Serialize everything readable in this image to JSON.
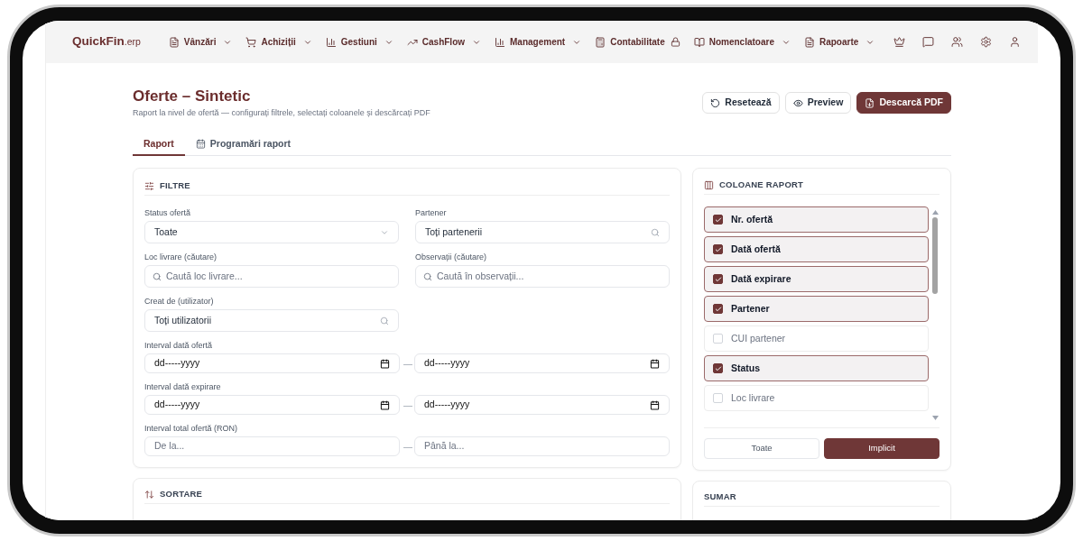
{
  "nav": {
    "logo": "**QuickFin**.erp",
    "menus": [
      {
        "label": "Vânzări",
        "kind": "dropdown"
      },
      {
        "label": "Achiziții",
        "kind": "dropdown"
      },
      {
        "label": "Gestiuni",
        "kind": "dropdown"
      },
      {
        "label": "CashFlow",
        "kind": "dropdown"
      },
      {
        "label": "Management",
        "kind": "dropdown"
      },
      {
        "label": "Contabilitate",
        "kind": "locked"
      },
      {
        "label": "Nomenclatoare",
        "kind": "dropdown"
      },
      {
        "label": "Rapoarte",
        "kind": "dropdown"
      }
    ]
  },
  "header": {
    "title": "Oferte – Sintetic",
    "subtitle": "Raport la nivel de ofertă — configurați filtrele, selectați coloanele și descărcați PDF",
    "actions": [
      {
        "label": "Resetează",
        "kind": "outline"
      },
      {
        "label": "Preview",
        "kind": "outline"
      },
      {
        "label": "Descarcă PDF",
        "kind": "primary"
      }
    ]
  },
  "tabs": [
    {
      "label": "Raport",
      "selected": true
    },
    {
      "label": "Programări raport",
      "selected": false
    }
  ],
  "filters": {
    "title": "FILTRE",
    "fields": [
      {
        "label": "Status ofertă",
        "kind": "select",
        "value": "Toate"
      },
      {
        "label": "Partener",
        "kind": "lookup",
        "value": "Toți partenerii"
      },
      {
        "label": "Loc livrare (căutare)",
        "kind": "search",
        "placeholder": "Caută loc livrare..."
      },
      {
        "label": "Observații (căutare)",
        "kind": "search",
        "placeholder": "Caută în observații..."
      },
      {
        "label": "Creat de (utilizator)",
        "kind": "lookup",
        "value": "Toți utilizatorii"
      },
      {
        "label": "Interval dată ofertă",
        "kind": "date_range",
        "from": {
          "placeholder": "dd-----yyyy"
        },
        "separator": "—",
        "to": {
          "placeholder": "dd-----yyyy"
        }
      },
      {
        "label": "Interval dată expirare",
        "kind": "date_range",
        "from": {
          "placeholder": "dd-----yyyy"
        },
        "separator": "—",
        "to": {
          "placeholder": "dd-----yyyy"
        }
      },
      {
        "label": "Interval total ofertă (RON)",
        "kind": "number_range",
        "from": {
          "placeholder": "De la..."
        },
        "separator": "—",
        "to": {
          "placeholder": "Până la..."
        }
      }
    ]
  },
  "sorting": {
    "title": "SORTARE"
  },
  "columns": {
    "title": "COLOANE RAPORT",
    "items": [
      {
        "label": "Nr. ofertă",
        "checked": true
      },
      {
        "label": "Dată ofertă",
        "checked": true
      },
      {
        "label": "Dată expirare",
        "checked": true
      },
      {
        "label": "Partener",
        "checked": true
      },
      {
        "label": "CUI partener",
        "checked": false
      },
      {
        "label": "Status",
        "checked": true
      },
      {
        "label": "Loc livrare",
        "checked": false
      }
    ],
    "buttons": [
      {
        "label": "Toate",
        "kind": "outline"
      },
      {
        "label": "Implicit",
        "kind": "primary"
      }
    ]
  },
  "summary": {
    "title": "SUMAR"
  }
}
